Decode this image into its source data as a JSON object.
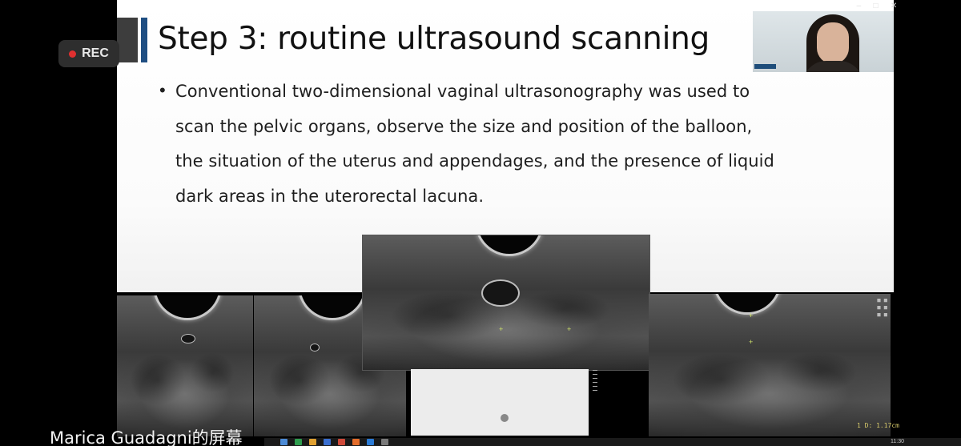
{
  "recording": {
    "label": "REC"
  },
  "slide": {
    "title": "Step 3: routine ultrasound scanning",
    "bullet_symbol": "•",
    "bullet_lines": [
      "Conventional two-dimensional vaginal ultrasonography was used to",
      "scan the pelvic organs, observe the size and position of the balloon,",
      "the situation of the uterus and appendages, and the presence of liquid",
      "dark areas in the uterorectal lacuna."
    ],
    "accent_color": "#1f4e82"
  },
  "ultrasound": {
    "readout": "1 D: 1.17cm"
  },
  "screen_share": {
    "presenter_label": "Marica Guadagni的屏幕",
    "clock": "11:30"
  },
  "icons": {
    "record": "record-dot-icon",
    "window_controls": [
      "minimize-icon",
      "maximize-icon",
      "close-icon"
    ]
  }
}
